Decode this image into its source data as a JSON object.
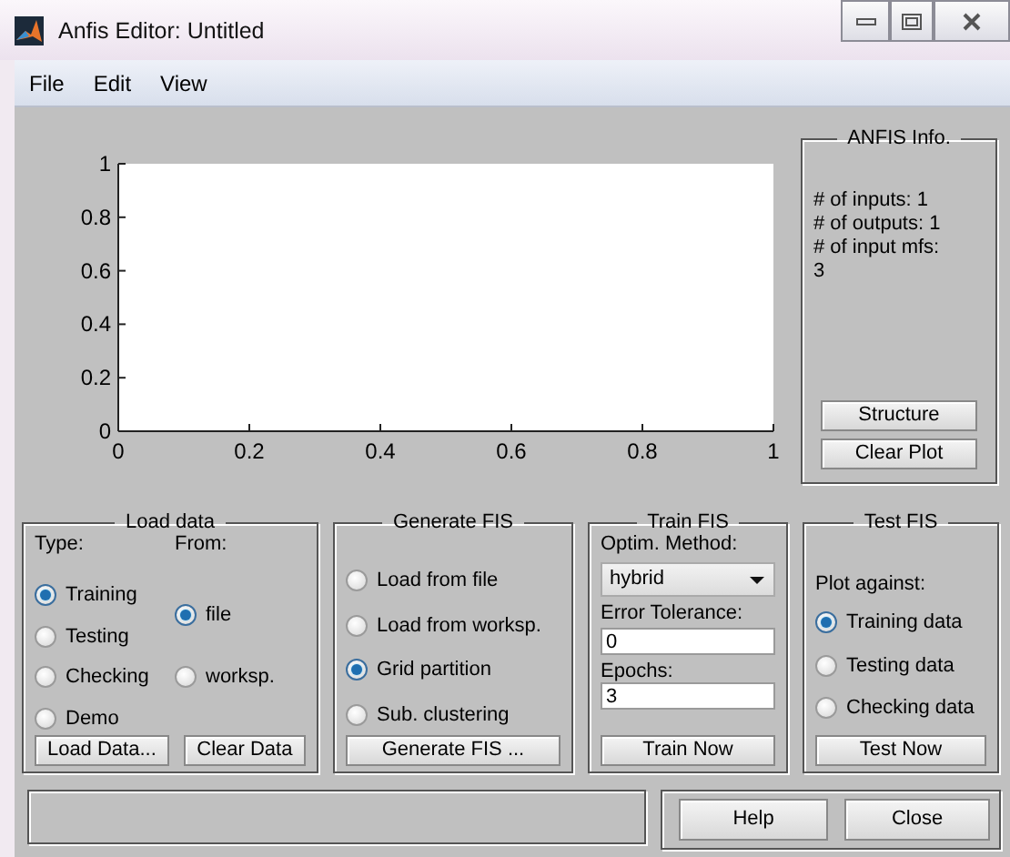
{
  "window": {
    "title": "Anfis Editor: Untitled"
  },
  "menu": [
    "File",
    "Edit",
    "View"
  ],
  "plot": {
    "chart_data": {
      "type": "line",
      "xlim": [
        0,
        1
      ],
      "ylim": [
        0,
        1
      ],
      "xticks": [
        0,
        0.2,
        0.4,
        0.6,
        0.8,
        1
      ],
      "yticks": [
        0,
        0.2,
        0.4,
        0.6,
        0.8,
        1
      ]
    }
  },
  "anfis_info": {
    "title": "ANFIS Info.",
    "lines": [
      "# of inputs: 1",
      "# of outputs: 1",
      "# of input mfs:",
      "3"
    ],
    "buttons": [
      "Structure",
      "Clear Plot"
    ]
  },
  "load_data": {
    "title": "Load data",
    "type_label": "Type:",
    "from_label": "From:",
    "types": [
      {
        "label": "Training",
        "selected": true
      },
      {
        "label": "Testing",
        "selected": false
      },
      {
        "label": "Checking",
        "selected": false
      },
      {
        "label": "Demo",
        "selected": false
      }
    ],
    "sources": [
      {
        "label": "file",
        "selected": true
      },
      {
        "label": "worksp.",
        "selected": false
      }
    ],
    "buttons": [
      "Load Data...",
      "Clear Data"
    ]
  },
  "generate_fis": {
    "title": "Generate FIS",
    "options": [
      {
        "label": "Load from file",
        "selected": false
      },
      {
        "label": "Load from worksp.",
        "selected": false
      },
      {
        "label": "Grid partition",
        "selected": true
      },
      {
        "label": "Sub. clustering",
        "selected": false
      }
    ],
    "button": "Generate FIS ..."
  },
  "train_fis": {
    "title": "Train FIS",
    "method_label": "Optim. Method:",
    "method": "hybrid",
    "tolerance_label": "Error Tolerance:",
    "tolerance": "0",
    "epochs_label": "Epochs:",
    "epochs": "3",
    "button": "Train Now"
  },
  "test_fis": {
    "title": "Test FIS",
    "plot_label": "Plot against:",
    "options": [
      {
        "label": "Training data",
        "selected": true
      },
      {
        "label": "Testing data",
        "selected": false
      },
      {
        "label": "Checking data",
        "selected": false
      }
    ],
    "button": "Test Now"
  },
  "buttons": [
    "Help",
    "Close"
  ]
}
